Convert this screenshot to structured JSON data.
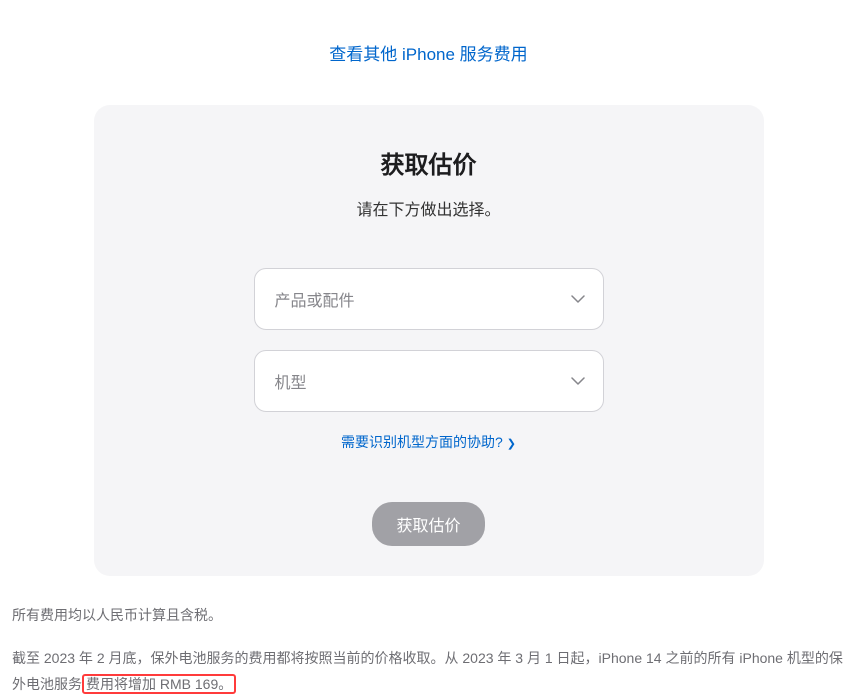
{
  "topLink": "查看其他 iPhone 服务费用",
  "card": {
    "title": "获取估价",
    "subtitle": "请在下方做出选择。",
    "productSelect": "产品或配件",
    "modelSelect": "机型",
    "helpLink": "需要识别机型方面的协助?",
    "submitButton": "获取估价"
  },
  "footer": {
    "note1": "所有费用均以人民币计算且含税。",
    "note2a": "截至 2023 年 2 月底，保外电池服务的费用都将按照当前的价格收取。从 2023 年 3 月 1 日起，iPhone 14 之前的所有 iPhone 机型的保外电池服务",
    "note2b": "费用将增加 RMB 169。"
  }
}
